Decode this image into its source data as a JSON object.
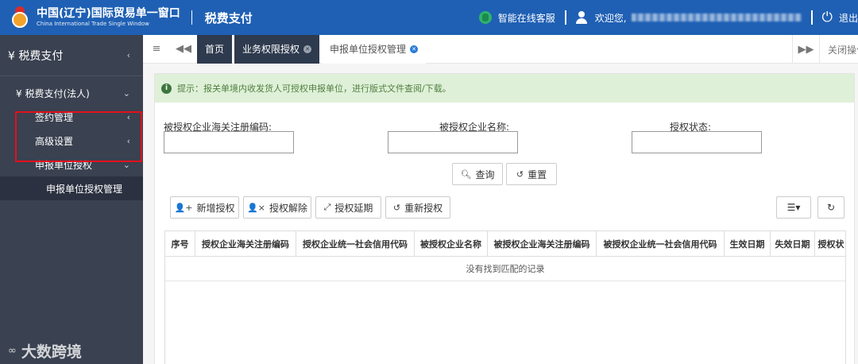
{
  "header": {
    "brand_cn": "中国(辽宁)国际贸易单一窗口",
    "brand_en": "China International Trade Single Window",
    "module_title": "税费支付",
    "customer_service": "智能在线客服",
    "welcome": "欢迎您,",
    "logout": "退出",
    "colors": {
      "header_bg": "#1f60b4"
    }
  },
  "sidebar": {
    "top": "¥ 税费支付",
    "group": "¥ 税费支付(法人)",
    "items": [
      {
        "label": "签约管理"
      },
      {
        "label": "高级设置"
      },
      {
        "label": "申报单位授权"
      }
    ],
    "subitem": "申报单位授权管理",
    "watermark": "大数跨境"
  },
  "tabs": {
    "home": "首页",
    "items": [
      {
        "label": "业务权限授权"
      },
      {
        "label": "申报单位授权管理"
      }
    ],
    "close_ops": "关闭操作"
  },
  "tip": "提示：报关单境内收发货人可授权申报单位，进行版式文件查阅/下载。",
  "form": {
    "field1_label": "被授权企业海关注册编码:",
    "field2_label": "被授权企业名称:",
    "field3_label": "授权状态:",
    "search_btn": "查询",
    "reset_btn": "重置"
  },
  "toolbar": {
    "add": "新增授权",
    "remove": "授权解除",
    "extend": "授权延期",
    "renew": "重新授权"
  },
  "table": {
    "columns": [
      "序号",
      "授权企业海关注册编码",
      "授权企业统一社会信用代码",
      "被授权企业名称",
      "被授权企业海关注册编码",
      "被授权企业统一社会信用代码",
      "生效日期",
      "失效日期",
      "授权状"
    ],
    "empty_text": "没有找到匹配的记录"
  }
}
